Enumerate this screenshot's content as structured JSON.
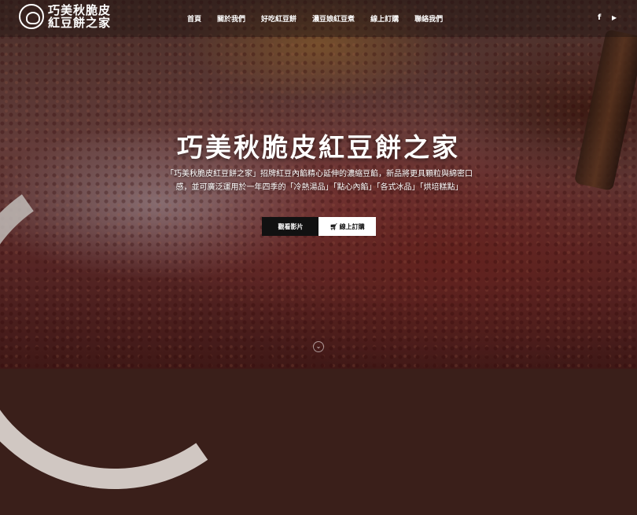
{
  "brand": {
    "line1": "巧美秋脆皮",
    "line2": "紅豆餅之家"
  },
  "nav": {
    "items": [
      "首頁",
      "關於我們",
      "好吃紅豆餅",
      "濃豆娘紅豆煮",
      "線上訂購",
      "聯絡我們"
    ]
  },
  "social": {
    "facebook_glyph": "f",
    "youtube_glyph": "▶"
  },
  "hero": {
    "title": "巧美秋脆皮紅豆餅之家",
    "description": "「巧美秋脆皮紅豆餅之家」招牌紅豆內餡精心延伸的濃縮豆餡，新品將更具顆粒與綿密口感，並可廣泛運用於一年四季的「冷熱湯品」「點心內餡」「各式冰品」「烘培糕點」",
    "watch_video": "觀看影片",
    "order_online": "線上訂購"
  },
  "icons": {
    "logo": "bean-logo-icon",
    "cart": "cart-icon",
    "scroll": "chevron-down-icon",
    "facebook": "facebook-icon",
    "youtube": "youtube-icon"
  }
}
